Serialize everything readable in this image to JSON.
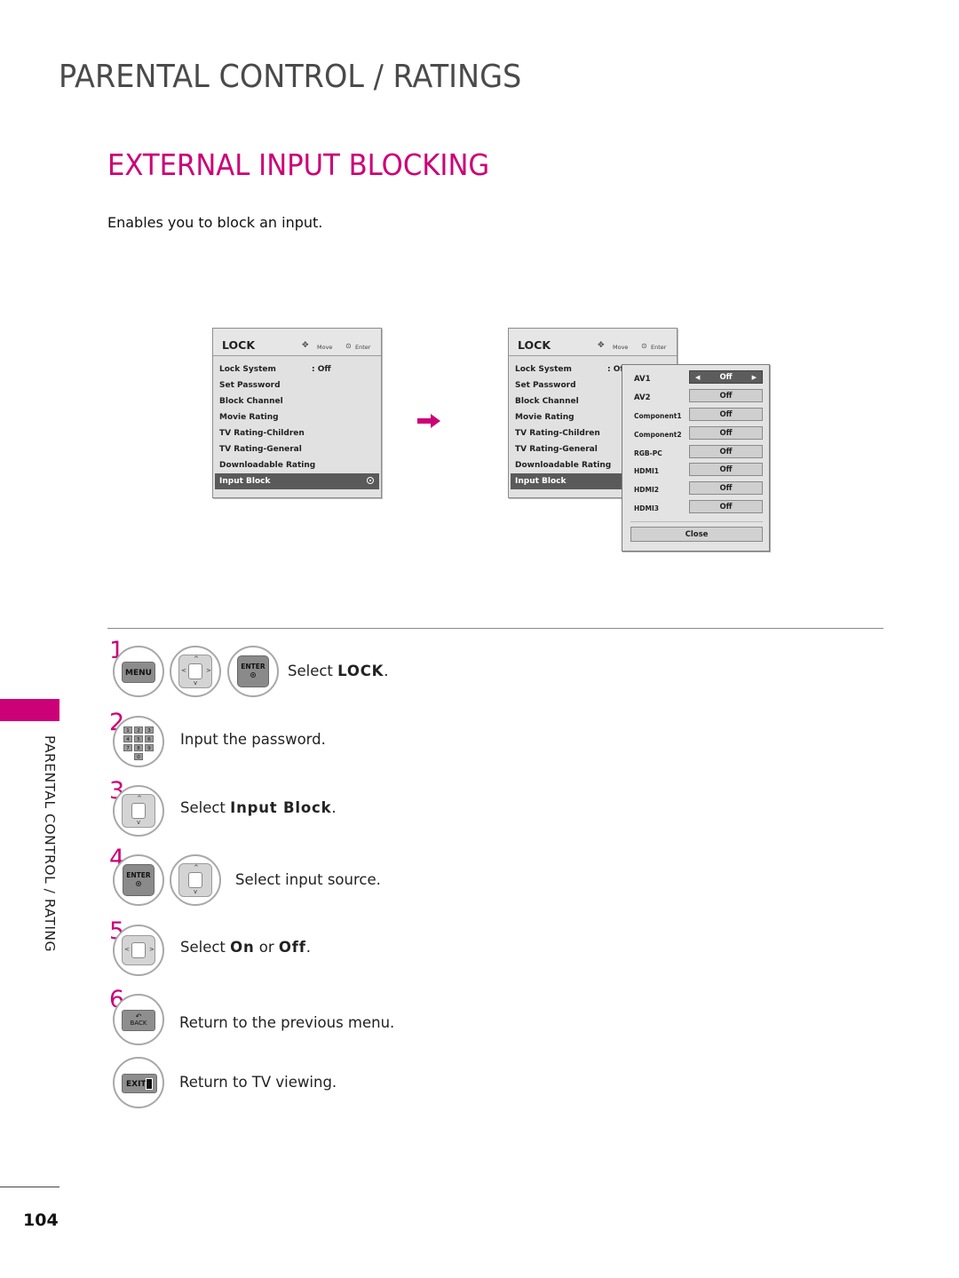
{
  "header": {
    "page_title": "PARENTAL CONTROL / RATINGS",
    "section_title": "EXTERNAL INPUT BLOCKING",
    "intro": "Enables you to block an input."
  },
  "colors": {
    "accent": "#cc0077",
    "title_gray": "#4a4a4a",
    "osd_background": "#e1e1e1",
    "osd_selected": "#5a5a5a"
  },
  "osd_left": {
    "title": "LOCK",
    "hint_move": "Move",
    "hint_enter": "Enter",
    "move_icon": "four-way-arrow-icon",
    "enter_icon": "enter-dot-icon",
    "items": [
      {
        "label": "Lock System",
        "value": ": Off"
      },
      {
        "label": "Set Password",
        "value": ""
      },
      {
        "label": "Block Channel",
        "value": ""
      },
      {
        "label": "Movie Rating",
        "value": ""
      },
      {
        "label": "TV Rating-Children",
        "value": ""
      },
      {
        "label": "TV Rating-General",
        "value": ""
      },
      {
        "label": "Downloadable Rating",
        "value": ""
      },
      {
        "label": "Input Block",
        "value": "",
        "selected": true
      }
    ]
  },
  "osd_right": {
    "title": "LOCK",
    "hint_move": "Move",
    "hint_enter": "Enter",
    "items": [
      {
        "label": "Lock System",
        "value": ": Of"
      },
      {
        "label": "Set Password"
      },
      {
        "label": "Block Channel"
      },
      {
        "label": "Movie Rating"
      },
      {
        "label": "TV Rating-Children"
      },
      {
        "label": "TV Rating-General"
      },
      {
        "label": "Downloadable Rating"
      },
      {
        "label": "Input Block",
        "selected": true
      }
    ],
    "popup": {
      "rows": [
        {
          "label": "AV1",
          "value": "Off",
          "active": true
        },
        {
          "label": "AV2",
          "value": "Off"
        },
        {
          "label": "Component1",
          "value": "Off"
        },
        {
          "label": "Component2",
          "value": "Off"
        },
        {
          "label": "RGB-PC",
          "value": "Off"
        },
        {
          "label": "HDMI1",
          "value": "Off"
        },
        {
          "label": "HDMI2",
          "value": "Off"
        },
        {
          "label": "HDMI3",
          "value": "Off"
        }
      ],
      "close_label": "Close",
      "left_arrow": "◀",
      "right_arrow": "▶"
    }
  },
  "transition_icon": "right-arrow-icon",
  "steps": [
    {
      "number": "1",
      "buttons": [
        "MENU",
        "dpad-4way",
        "ENTER"
      ],
      "text_pre": "Select ",
      "text_bold": "LOCK",
      "text_post": "."
    },
    {
      "number": "2",
      "buttons": [
        "numpad"
      ],
      "text_pre": "Input the password.",
      "text_bold": "",
      "text_post": ""
    },
    {
      "number": "3",
      "buttons": [
        "dpad-updown"
      ],
      "text_pre": "Select ",
      "text_bold": "Input Block",
      "text_post": "."
    },
    {
      "number": "4",
      "buttons": [
        "ENTER",
        "dpad-updown"
      ],
      "text_pre": "Select input source.",
      "text_bold": "",
      "text_post": ""
    },
    {
      "number": "5",
      "buttons": [
        "dpad-leftright"
      ],
      "text_pre": "Select ",
      "text_bold": "On",
      "text_mid": " or ",
      "text_bold2": "Off",
      "text_post": "."
    },
    {
      "number": "6",
      "buttons": [
        "BACK"
      ],
      "text_pre": "Return to the previous menu.",
      "text_bold": "",
      "text_post": ""
    },
    {
      "number": "",
      "buttons": [
        "EXIT"
      ],
      "text_pre": "Return to TV viewing.",
      "text_bold": "",
      "text_post": ""
    }
  ],
  "remote_labels": {
    "menu": "MENU",
    "enter": "ENTER",
    "back": "BACK",
    "exit": "EXIT",
    "keys": [
      "1",
      "2",
      "3",
      "4",
      "5",
      "6",
      "7",
      "8",
      "9",
      "0"
    ],
    "up": "^",
    "down": "v",
    "left": "<",
    "right": ">"
  },
  "sidebar": {
    "label": "PARENTAL CONTROL / RATING"
  },
  "footer": {
    "page_number": "104"
  }
}
